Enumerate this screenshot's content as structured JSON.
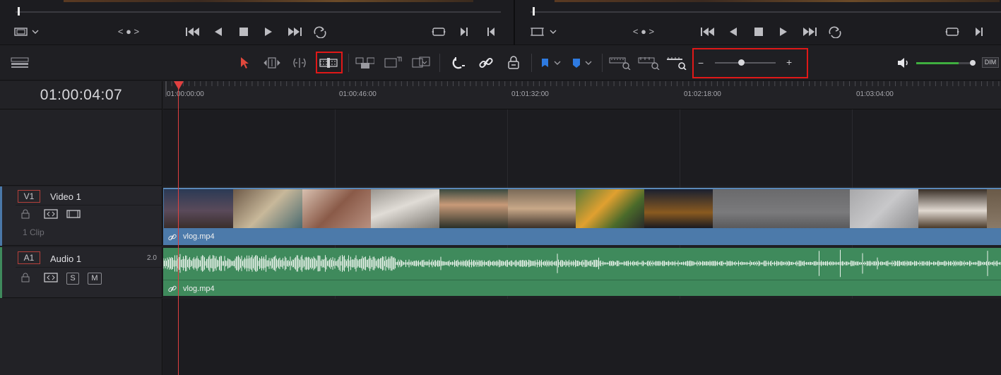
{
  "source_viewer": {
    "view_options_icon": "viewer-options-icon",
    "jog_label": "< ● >"
  },
  "timeline_viewer": {
    "jog_label": "< ● >"
  },
  "toolbar": {
    "volume_label": "DIM",
    "zoom_minus": "−",
    "zoom_plus": "+",
    "volume_level": 0.75,
    "zoom_level": 0.43
  },
  "timeline": {
    "timecode": "01:00:04:07",
    "ruler_labels": [
      "01:00:00:00",
      "01:00:46:00",
      "01:01:32:00",
      "01:02:18:00",
      "01:03:04:00"
    ]
  },
  "tracks": {
    "video": {
      "id": "V1",
      "name": "Video 1",
      "clip_count": "1 Clip",
      "clip_name": "vlog.mp4"
    },
    "audio": {
      "id": "A1",
      "name": "Audio 1",
      "channels": "2.0",
      "solo": "S",
      "mute": "M",
      "clip_name": "vlog.mp4"
    }
  },
  "colors": {
    "video_clip": "#4a78a8",
    "audio_clip": "#3f8a5c",
    "playhead": "#e04040",
    "highlight": "#e01818"
  }
}
